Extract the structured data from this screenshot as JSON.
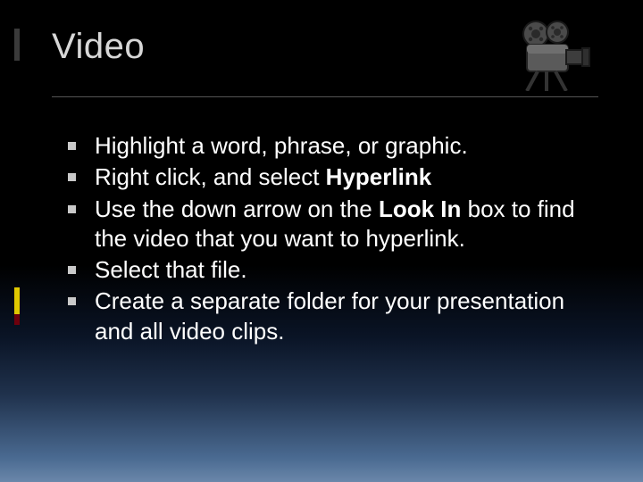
{
  "title": "Video",
  "icon": "video-camera-icon",
  "bullets": [
    {
      "segments": [
        {
          "text": "Highlight a word, phrase, or graphic.",
          "bold": false
        }
      ]
    },
    {
      "segments": [
        {
          "text": "Right click, and select ",
          "bold": false
        },
        {
          "text": "Hyperlink",
          "bold": true
        }
      ]
    },
    {
      "segments": [
        {
          "text": "Use the down arrow on the ",
          "bold": false
        },
        {
          "text": "Look In",
          "bold": true
        },
        {
          "text": " box to find the video that you want to hyperlink.",
          "bold": false
        }
      ]
    },
    {
      "segments": [
        {
          "text": "Select that file.",
          "bold": false
        }
      ]
    },
    {
      "segments": [
        {
          "text": "Create a separate folder for your presentation and all video clips.",
          "bold": false
        }
      ]
    }
  ]
}
